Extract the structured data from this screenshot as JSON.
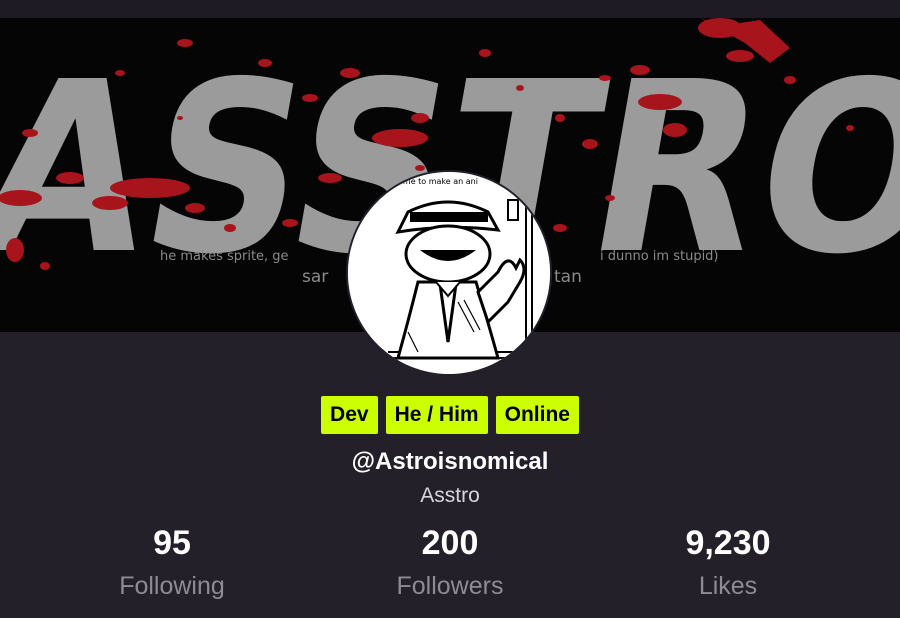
{
  "banner": {
    "title": "ASSTRO",
    "caption_line1": "he makes sprite, ge",
    "caption_line1_right": "i dunno im stupid)",
    "caption_line2_left": "sar",
    "caption_line2_right": "tan"
  },
  "avatar": {
    "caption": "ome to make an ani"
  },
  "badges": [
    "Dev",
    "He / Him",
    "Online"
  ],
  "profile": {
    "handle": "@Astroisnomical",
    "display_name": "Asstro"
  },
  "stats": [
    {
      "value": "95",
      "label": "Following"
    },
    {
      "value": "200",
      "label": "Followers"
    },
    {
      "value": "9,230",
      "label": "Likes"
    }
  ],
  "colors": {
    "background": "#232029",
    "badge": "#ccff00",
    "banner_title": "#9b9b9b",
    "blood": "#a8141c"
  }
}
